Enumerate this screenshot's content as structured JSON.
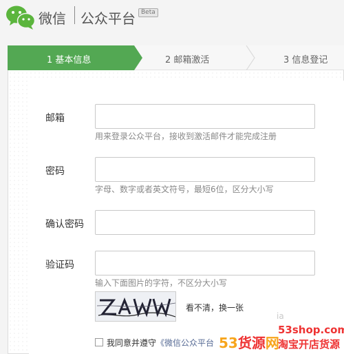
{
  "header": {
    "brand": "微信",
    "platform": "公众平台",
    "beta": "Beta"
  },
  "steps": [
    {
      "label": "1 基本信息",
      "active": true
    },
    {
      "label": "2 邮箱激活",
      "active": false
    },
    {
      "label": "3 信息登记",
      "active": false
    }
  ],
  "form": {
    "email": {
      "label": "邮箱",
      "value": "",
      "hint": "用来登录公众平台，接收到激活邮件才能完成注册"
    },
    "password": {
      "label": "密码",
      "value": "",
      "hint": "字母、数字或者英文符号，最短6位，区分大小写"
    },
    "confirm": {
      "label": "确认密码",
      "value": ""
    },
    "captcha": {
      "label": "验证码",
      "value": "",
      "hint": "输入下面图片的字符，不区分大小写",
      "refresh": "看不清，换一张"
    },
    "agree": {
      "prefix": "我同意并遵守",
      "link": "《微信公众平台"
    }
  },
  "watermark": {
    "site": "53shop.com",
    "brand_a": "53",
    "brand_b": "货源",
    "brand_c": "网",
    "tagline": "淘宝开店货源",
    "faint": "ia"
  },
  "colors": {
    "step_active": "#53a853",
    "link": "#576b95",
    "watermark_orange": "#f7a51c",
    "watermark_red": "#e33333"
  }
}
